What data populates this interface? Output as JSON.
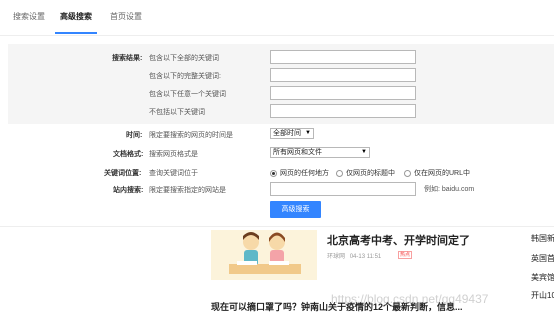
{
  "tabs": [
    {
      "label": "搜索设置"
    },
    {
      "label": "高级搜索"
    },
    {
      "label": "首页设置"
    }
  ],
  "advanced": {
    "result_label": "搜索结果:",
    "all_words_hint": "包含以下全部的关键词",
    "exact_phrase_hint": "包含以下的完整关键词:",
    "any_words_hint": "包含以下任意一个关键词",
    "exclude_words_hint": "不包括以下关键词",
    "time_label": "时间:",
    "time_hint": "限定要搜索的网页的时间是",
    "time_value": "全部时间",
    "format_label": "文档格式:",
    "format_hint": "搜索网页格式是",
    "format_value": "所有网页和文件",
    "position_label": "关键词位置:",
    "position_hint": "查询关键词位于",
    "position_options": [
      "网页的任何地方",
      "仅网页的标题中",
      "仅在网页的URL中"
    ],
    "position_selected": 0,
    "site_label": "站内搜索:",
    "site_hint": "限定要搜索指定的网站是",
    "site_example": "例如: baidu.com",
    "submit_label": "高级搜索"
  },
  "feed": {
    "headline": "北京高考中考、开学时间定了",
    "source": "环球网",
    "time": "04-13 11:51",
    "hot_badge": "热点",
    "headline2": "现在可以摘口罩了吗？钟南山关于疫情的12个最新判断，信息...",
    "side_items": [
      "韩国新",
      "英国首",
      "美宾馆",
      "开山10"
    ]
  },
  "watermark": "https://blog.csdn.net/qq49437"
}
